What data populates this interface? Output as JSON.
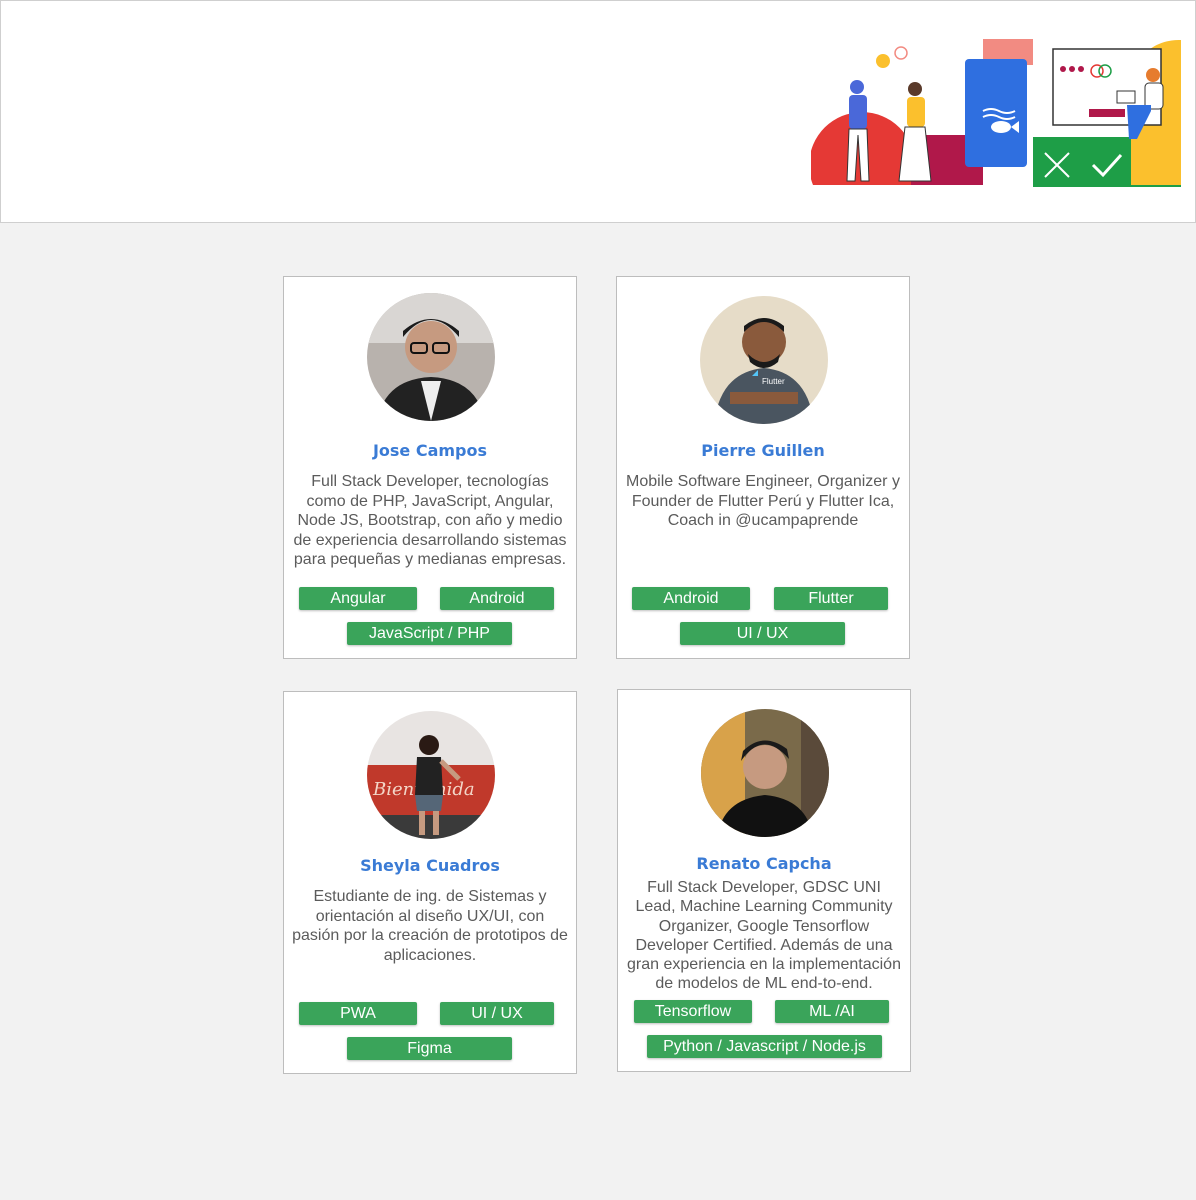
{
  "colors": {
    "accent_blue": "#3a7bd5",
    "chip_green": "#3aa45a",
    "background": "#f2f2f2"
  },
  "header": {
    "illustration_icon": "teamwork-illustration"
  },
  "members": [
    {
      "name": "Jose Campos",
      "description": "Full Stack Developer, tecnologías como de PHP, JavaScript, Angular, Node JS, Bootstrap, con año y medio de experiencia desarrollando sistemas para pequeñas y medianas empresas.",
      "tags": [
        "Angular",
        "Android",
        "JavaScript / PHP"
      ]
    },
    {
      "name": "Pierre Guillen",
      "description": "Mobile Software Engineer, Organizer y Founder de Flutter Perú y Flutter Ica, Coach in @ucampaprende",
      "tags": [
        "Android",
        "Flutter",
        "UI / UX"
      ]
    },
    {
      "name": "Sheyla Cuadros",
      "description": "Estudiante de ing. de Sistemas y orientación al diseño UX/UI, con pasión por la creación de prototipos de aplicaciones.",
      "tags": [
        "PWA",
        "UI / UX",
        "Figma"
      ]
    },
    {
      "name": "Renato Capcha",
      "description": "Full Stack Developer, GDSC UNI Lead, Machine Learning Community Organizer, Google Tensorflow Developer Certified. Además de una gran experiencia en la implementación de modelos de ML end-to-end.",
      "tags": [
        "Tensorflow",
        "ML /AI",
        "Python / Javascript / Node.js"
      ]
    }
  ]
}
